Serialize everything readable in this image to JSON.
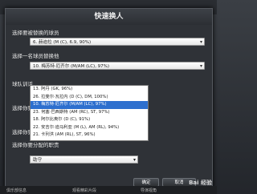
{
  "dialog": {
    "title": "快速换人",
    "label_player_to_replace": "选择要被替换的球员",
    "player_to_replace_value": "6. 赫迪拉 (M (C), 6.9, 90%)",
    "label_replacement": "选择一名球员替换他",
    "replacement_value": "10. 梅苏特·厄齐尔 (M/AM (LC), 97%)",
    "label_team_instructions": "球队训话",
    "label_assign_1": "选择你要分配的",
    "label_assign_2": "选择你要分配的",
    "label_assign_3": "选择你要分配的职责",
    "duty_value": "助守",
    "list_items": [
      "13. 阿丹 (GK, 96%)",
      "26. 拉斐尔·瓦拉内 (D (C), DM, 100%)",
      "10. 梅苏特·厄齐尔 (M/AM (LC), 97%)",
      "23. 何塞·巴西斯特 (AM (RC), ST, 97%)",
      "18. 阿尔比奥尔 (D (C), 91%)",
      "22. 安吉尔·迪马利亚 (M (L), AM (RL), 94%)",
      "21. 卡列洪 (AM (RL), ST, 96%)"
    ],
    "selected_index": 2,
    "ok_label": "确定",
    "cancel_label": "取消"
  },
  "footer": {
    "item1": "俱乐部信息",
    "item2": "观看精彩片段",
    "item3": "导演视角"
  },
  "watermark": "Bai 经验"
}
